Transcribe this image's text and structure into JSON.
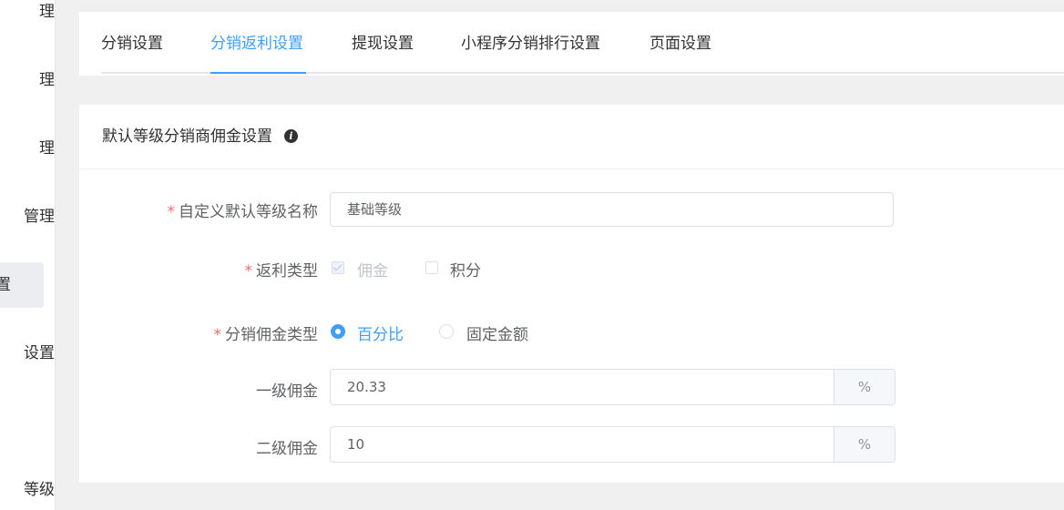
{
  "sidebar": {
    "items": [
      {
        "label": "理"
      },
      {
        "label": "理"
      },
      {
        "label": "理"
      },
      {
        "label": "管理"
      },
      {
        "label": "置"
      },
      {
        "label": "设置"
      },
      {
        "label": "等级"
      }
    ]
  },
  "tabs": [
    {
      "label": "分销设置"
    },
    {
      "label": "分销返利设置"
    },
    {
      "label": "提现设置"
    },
    {
      "label": "小程序分销排行设置"
    },
    {
      "label": "页面设置"
    }
  ],
  "card": {
    "title": "默认等级分销商佣金设置",
    "info_icon": "info-icon"
  },
  "form": {
    "level_name": {
      "label": "自定义默认等级名称",
      "required": "*",
      "value": "基础等级"
    },
    "rebate_type": {
      "label": "返利类型",
      "required": "*",
      "options": [
        {
          "label": "佣金",
          "checked": true,
          "disabled": true
        },
        {
          "label": "积分",
          "checked": false,
          "disabled": false
        }
      ]
    },
    "commission_type": {
      "label": "分销佣金类型",
      "required": "*",
      "options": [
        {
          "label": "百分比",
          "selected": true
        },
        {
          "label": "固定金额",
          "selected": false
        }
      ]
    },
    "level1": {
      "label": "一级佣金",
      "value": "20.33",
      "unit": "%"
    },
    "level2": {
      "label": "二级佣金",
      "value": "10",
      "unit": "%"
    }
  },
  "colors": {
    "accent": "#409eff",
    "required": "#f56c6c"
  }
}
